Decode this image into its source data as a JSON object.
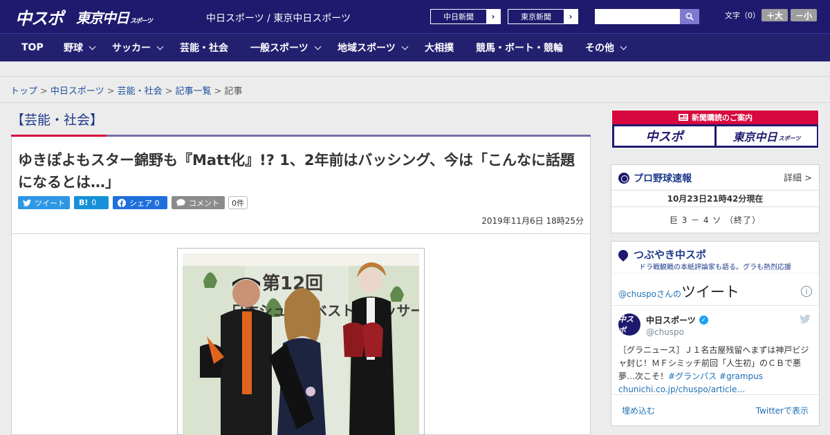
{
  "header": {
    "logo_chuspo": "中スポ",
    "logo_tokyo": "東京中日",
    "logo_tokyo_small": "スポーツ",
    "site_name": "中日スポーツ / 東京中日スポーツ",
    "ext_links": [
      {
        "label": "中日新聞",
        "arrow": "›"
      },
      {
        "label": "東京新聞",
        "arrow": "›"
      }
    ],
    "search_placeholder": "",
    "font_label": "文字（0）",
    "font_plus": "＋大",
    "font_minus": "－小"
  },
  "nav": {
    "items": [
      {
        "label": "TOP"
      },
      {
        "label": "野球"
      },
      {
        "label": "サッカー"
      },
      {
        "label": "芸能・社会"
      },
      {
        "label": "一般スポーツ"
      },
      {
        "label": "地域スポーツ"
      },
      {
        "label": "大相撲"
      },
      {
        "label": "競馬・ボート・競輪"
      },
      {
        "label": "その他"
      }
    ]
  },
  "breadcrumb": {
    "items": [
      "トップ",
      "中日スポーツ",
      "芸能・社会",
      "記事一覧"
    ],
    "current": "記事",
    "sep": ">"
  },
  "article": {
    "category": "【芸能・社会】",
    "title": "ゆきぽよもスター錦野も『Matt化』!? 1、2年前はバッシング、今は「こんなに話題になるとは…」",
    "share": {
      "tweet": "ツイート",
      "hatena_icon": "B!",
      "hatena_count": "0",
      "facebook": "シェア 0",
      "comment": "コメント",
      "comment_count": "0件"
    },
    "date": "2019年11月6日 18時25分",
    "photo": {
      "banner_line1": "第12回",
      "banner_line2": "日本シューズベストドレッサー賞"
    }
  },
  "sidebar": {
    "subscribe": {
      "head": "新聞購読のご案内",
      "logo1": "中スポ",
      "logo2": "東京中日",
      "logo2_small": "スポーツ"
    },
    "baseball": {
      "title": "プロ野球速報",
      "detail": "詳細 >",
      "time": "10月23日21時42分現在",
      "score": "巨 3 － 4 ソ （終了）"
    },
    "twitter": {
      "title": "つぶやき中スポ",
      "subtitle": "ドラ戦観戦の本紙評論家も語る。グラも熱烈応援",
      "handle_prefix": "@chuspoさんの",
      "heading": "ツイート",
      "info": "i",
      "avatar_text": "中スポ",
      "name": "中日スポーツ",
      "handle": "@chuspo",
      "text_plain": "［グラニュース］Ｊ１名古屋残留へまずは神戸ビジャ封じ！ＭＦシミッチ前回「人生初」のＣＢで悪夢…次こそ！",
      "tag1": "#グランパス",
      "tag2": "#grampus",
      "link": "chunichi.co.jp/chuspo/article…",
      "embed": "埋め込む",
      "view": "Twitterで表示"
    }
  }
}
